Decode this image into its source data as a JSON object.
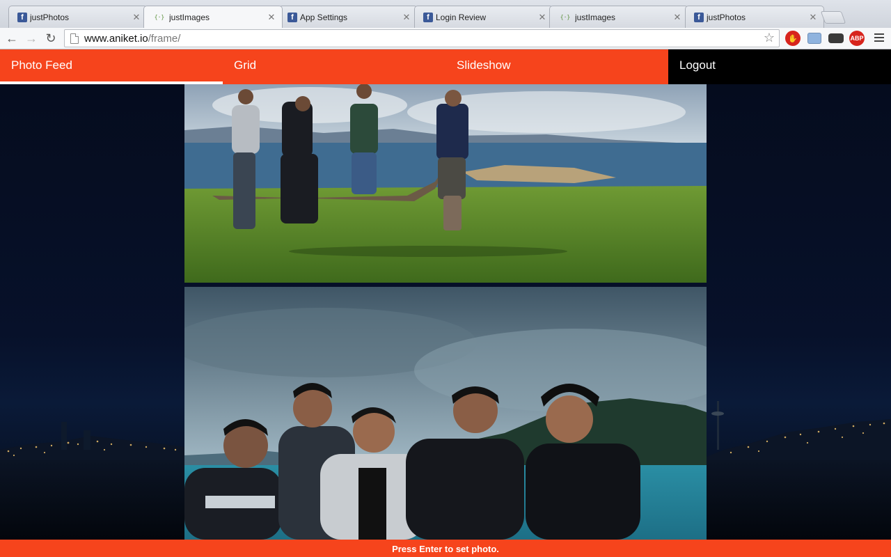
{
  "browser": {
    "tabs": [
      {
        "title": "justPhotos",
        "icon": "facebook-icon",
        "active": false
      },
      {
        "title": "justImages",
        "icon": "code-icon",
        "active": true
      },
      {
        "title": "App Settings",
        "icon": "facebook-icon",
        "active": false
      },
      {
        "title": "Login Review",
        "icon": "facebook-icon",
        "active": false
      },
      {
        "title": "justImages",
        "icon": "code-icon",
        "active": false
      },
      {
        "title": "justPhotos",
        "icon": "facebook-icon",
        "active": false
      }
    ],
    "url_host": "www.aniket.io",
    "url_path": "/frame/",
    "extensions": [
      "stop-icon",
      "screenshot-icon",
      "incognito-mask-icon",
      "adblock-plus-icon"
    ]
  },
  "nav": {
    "items": [
      {
        "label": "Photo Feed",
        "active": true
      },
      {
        "label": "Grid",
        "active": false
      },
      {
        "label": "Slideshow",
        "active": false
      },
      {
        "label": "Logout",
        "active": false
      }
    ]
  },
  "feed": {
    "photos": [
      {
        "name": "jumping-group-photo"
      },
      {
        "name": "group-portrait-photo"
      }
    ]
  },
  "status": {
    "message": "Press Enter to set photo."
  },
  "colors": {
    "accent": "#f6441c",
    "logout_bg": "#000000",
    "background": "#0a1020"
  }
}
